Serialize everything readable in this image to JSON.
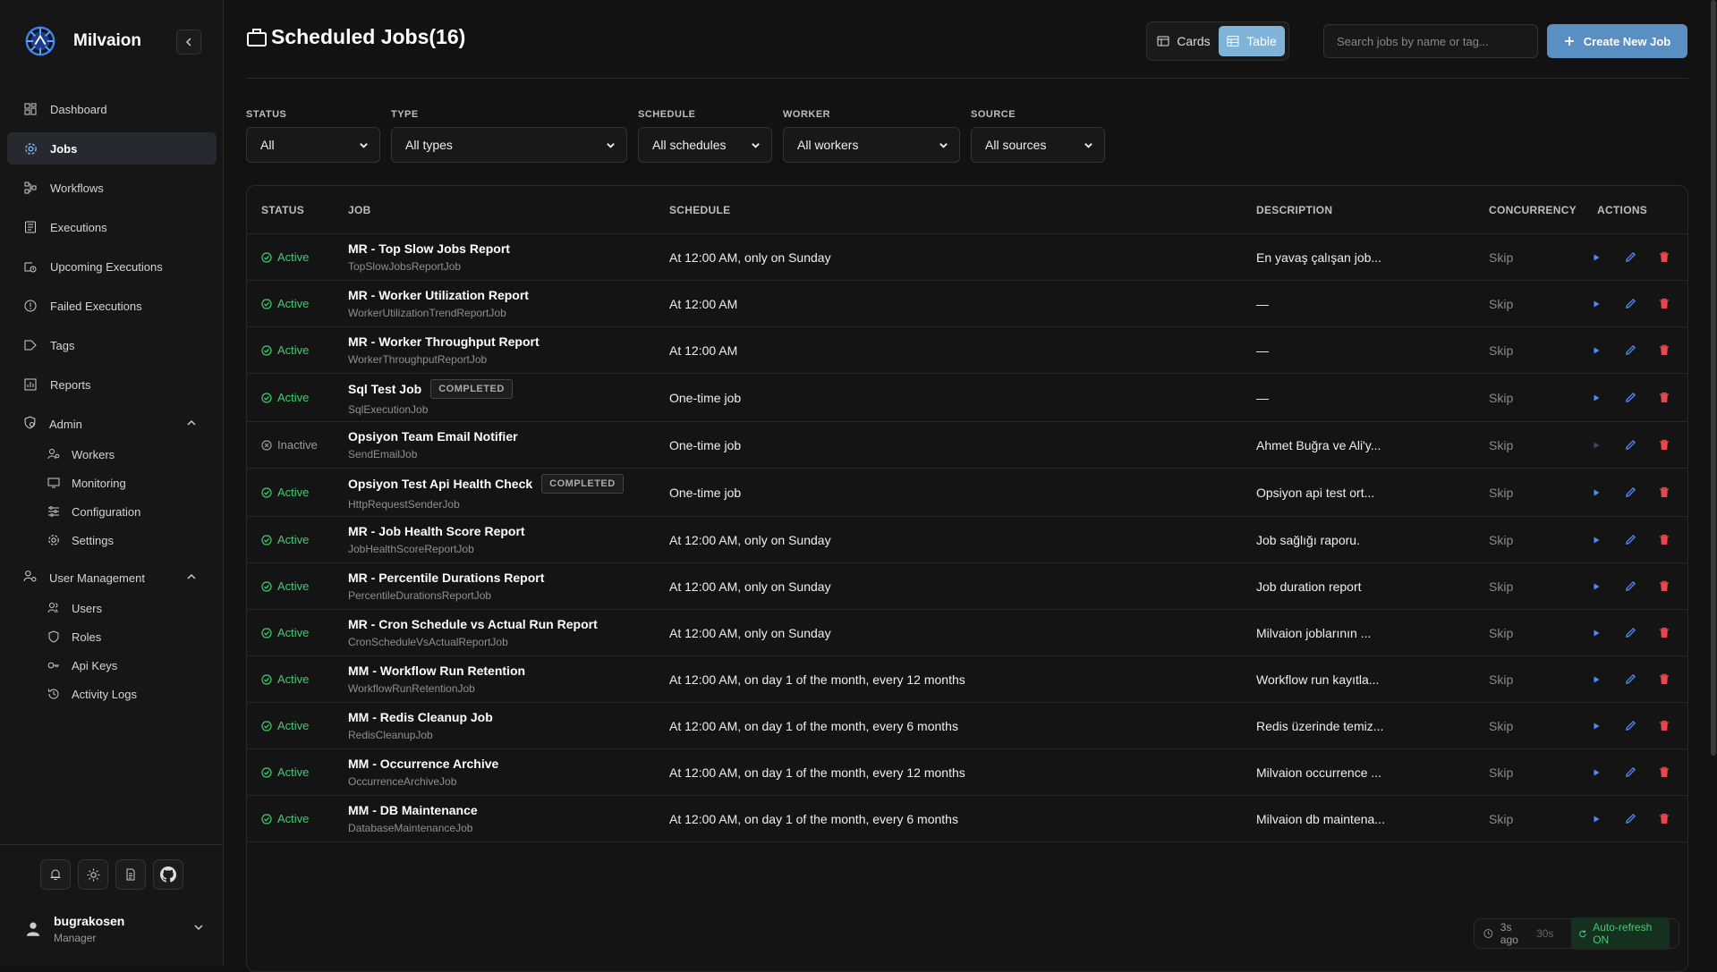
{
  "app": {
    "name": "Milvaion"
  },
  "nav": {
    "items": [
      {
        "label": "Dashboard",
        "icon": "dashboard-icon"
      },
      {
        "label": "Jobs",
        "icon": "gear-icon",
        "active": true
      },
      {
        "label": "Workflows",
        "icon": "workflow-icon"
      },
      {
        "label": "Executions",
        "icon": "list-icon"
      },
      {
        "label": "Upcoming Executions",
        "icon": "calendar-clock-icon"
      },
      {
        "label": "Failed Executions",
        "icon": "alert-circle-icon"
      },
      {
        "label": "Tags",
        "icon": "tag-icon"
      },
      {
        "label": "Reports",
        "icon": "chart-icon"
      }
    ],
    "admin": {
      "label": "Admin",
      "items": [
        {
          "label": "Workers"
        },
        {
          "label": "Monitoring"
        },
        {
          "label": "Configuration"
        },
        {
          "label": "Settings"
        }
      ]
    },
    "user_management": {
      "label": "User Management",
      "items": [
        {
          "label": "Users"
        },
        {
          "label": "Roles"
        },
        {
          "label": "Api Keys"
        },
        {
          "label": "Activity Logs"
        }
      ]
    }
  },
  "user": {
    "name": "bugrakosen",
    "role": "Manager"
  },
  "page": {
    "title": "Scheduled Jobs(16)",
    "view_cards": "Cards",
    "view_table": "Table",
    "search_placeholder": "Search jobs by name or tag...",
    "create_label": "Create New Job"
  },
  "filters": {
    "status": {
      "label": "STATUS",
      "value": "All"
    },
    "type": {
      "label": "TYPE",
      "value": "All types"
    },
    "schedule": {
      "label": "SCHEDULE",
      "value": "All schedules"
    },
    "worker": {
      "label": "WORKER",
      "value": "All workers"
    },
    "source": {
      "label": "SOURCE",
      "value": "All sources"
    }
  },
  "table": {
    "headers": {
      "status": "STATUS",
      "job": "JOB",
      "schedule": "SCHEDULE",
      "description": "DESCRIPTION",
      "concurrency": "CONCURRENCY",
      "actions": "ACTIONS"
    },
    "rows": [
      {
        "status": "Active",
        "name": "MR - Top Slow Jobs Report",
        "type": "TopSlowJobsReportJob",
        "badge": "",
        "schedule": "At 12:00 AM, only on Sunday",
        "description": "En yavaş çalışan job...",
        "concurrency": "Skip"
      },
      {
        "status": "Active",
        "name": "MR - Worker Utilization Report",
        "type": "WorkerUtilizationTrendReportJob",
        "badge": "",
        "schedule": "At 12:00 AM",
        "description": "—",
        "concurrency": "Skip"
      },
      {
        "status": "Active",
        "name": "MR - Worker Throughput Report",
        "type": "WorkerThroughputReportJob",
        "badge": "",
        "schedule": "At 12:00 AM",
        "description": "—",
        "concurrency": "Skip"
      },
      {
        "status": "Active",
        "name": "Sql Test Job",
        "type": "SqlExecutionJob",
        "badge": "COMPLETED",
        "schedule": "One-time job",
        "description": "—",
        "concurrency": "Skip"
      },
      {
        "status": "Inactive",
        "name": "Opsiyon Team Email Notifier",
        "type": "SendEmailJob",
        "badge": "",
        "schedule": "One-time job",
        "description": "Ahmet Buğra ve Ali'y...",
        "concurrency": "Skip"
      },
      {
        "status": "Active",
        "name": "Opsiyon Test Api Health Check",
        "type": "HttpRequestSenderJob",
        "badge": "COMPLETED",
        "schedule": "One-time job",
        "description": "Opsiyon api test ort...",
        "concurrency": "Skip"
      },
      {
        "status": "Active",
        "name": "MR - Job Health Score Report",
        "type": "JobHealthScoreReportJob",
        "badge": "",
        "schedule": "At 12:00 AM, only on Sunday",
        "description": "Job sağlığı raporu.",
        "concurrency": "Skip"
      },
      {
        "status": "Active",
        "name": "MR - Percentile Durations Report",
        "type": "PercentileDurationsReportJob",
        "badge": "",
        "schedule": "At 12:00 AM, only on Sunday",
        "description": "Job duration report",
        "concurrency": "Skip"
      },
      {
        "status": "Active",
        "name": "MR - Cron Schedule vs Actual Run Report",
        "type": "CronScheduleVsActualReportJob",
        "badge": "",
        "schedule": "At 12:00 AM, only on Sunday",
        "description": "Milvaion joblarının ...",
        "concurrency": "Skip"
      },
      {
        "status": "Active",
        "name": "MM - Workflow Run Retention",
        "type": "WorkflowRunRetentionJob",
        "badge": "",
        "schedule": "At 12:00 AM, on day 1 of the month, every 12 months",
        "description": "Workflow run kayıtla...",
        "concurrency": "Skip"
      },
      {
        "status": "Active",
        "name": "MM - Redis Cleanup Job",
        "type": "RedisCleanupJob",
        "badge": "",
        "schedule": "At 12:00 AM, on day 1 of the month, every 6 months",
        "description": "Redis üzerinde temiz...",
        "concurrency": "Skip"
      },
      {
        "status": "Active",
        "name": "MM - Occurrence Archive",
        "type": "OccurrenceArchiveJob",
        "badge": "",
        "schedule": "At 12:00 AM, on day 1 of the month, every 12 months",
        "description": "Milvaion occurrence ...",
        "concurrency": "Skip"
      },
      {
        "status": "Active",
        "name": "MM - DB Maintenance",
        "type": "DatabaseMaintenanceJob",
        "badge": "",
        "schedule": "At 12:00 AM, on day 1 of the month, every 6 months",
        "description": "Milvaion db maintena...",
        "concurrency": "Skip"
      }
    ]
  },
  "refresh": {
    "ago": "3s ago",
    "interval": "30s",
    "state": "Auto-refresh ON"
  },
  "colors": {
    "active": "#3ecf6e",
    "accent": "#5a8fc4",
    "delete": "#e5484d",
    "edit": "#4f8cff"
  }
}
